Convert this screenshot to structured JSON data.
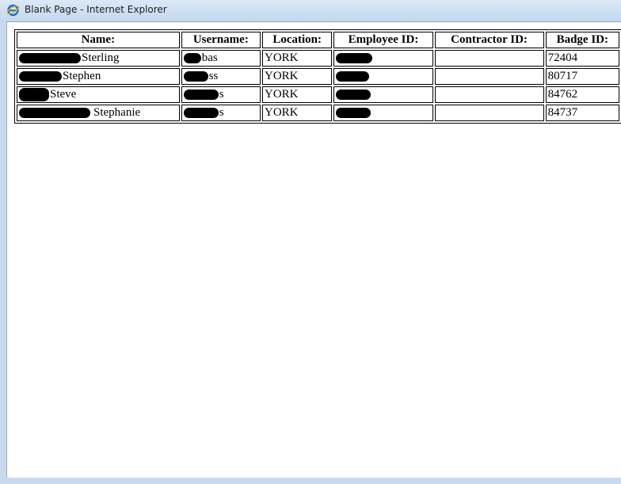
{
  "window": {
    "title": "Blank Page - Internet Explorer",
    "icon": "internet-explorer-icon"
  },
  "table": {
    "columns": [
      "Name:",
      "Username:",
      "Location:",
      "Employee ID:",
      "Contractor ID:",
      "Badge ID:"
    ],
    "rows": [
      {
        "name": "Sterling",
        "username": "bas",
        "location": "YORK",
        "employee_id": "",
        "contractor_id": "",
        "badge_id": "72404"
      },
      {
        "name": "Stephen",
        "username": "ss",
        "location": "YORK",
        "employee_id": "",
        "contractor_id": "",
        "badge_id": "80717"
      },
      {
        "name": "Steve",
        "username": "s",
        "location": "YORK",
        "employee_id": "",
        "contractor_id": "",
        "badge_id": "84762"
      },
      {
        "name": "Stephanie",
        "username": "s",
        "location": "YORK",
        "employee_id": "",
        "contractor_id": "",
        "badge_id": "84737"
      }
    ]
  }
}
